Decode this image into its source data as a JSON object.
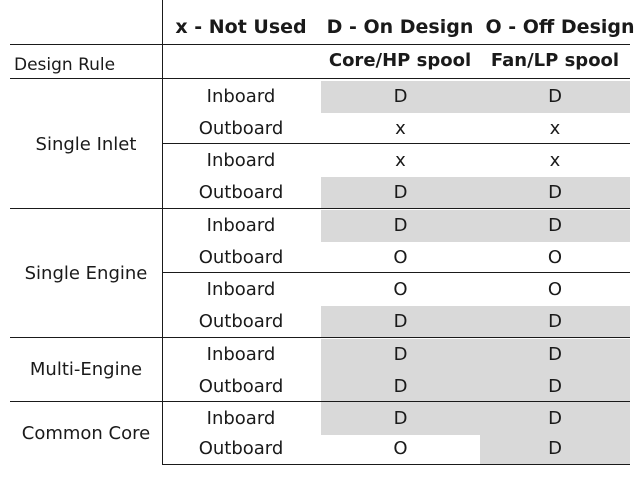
{
  "header": {
    "legend_x": "x - Not Used",
    "legend_d": "D - On Design",
    "legend_o": "O - Off Design",
    "col_design_rule": "Design Rule",
    "col_core": "Core/HP spool",
    "col_fan": "Fan/LP spool"
  },
  "groups": [
    {
      "label": "Single Inlet"
    },
    {
      "label": "Single Engine"
    },
    {
      "label": "Multi-Engine"
    },
    {
      "label": "Common Core"
    }
  ],
  "rows": [
    {
      "position": "Inboard",
      "core": "D",
      "fan": "D",
      "core_gray": true,
      "fan_gray": true
    },
    {
      "position": "Outboard",
      "core": "x",
      "fan": "x",
      "core_gray": false,
      "fan_gray": false
    },
    {
      "position": "Inboard",
      "core": "x",
      "fan": "x",
      "core_gray": false,
      "fan_gray": false
    },
    {
      "position": "Outboard",
      "core": "D",
      "fan": "D",
      "core_gray": true,
      "fan_gray": true
    },
    {
      "position": "Inboard",
      "core": "D",
      "fan": "D",
      "core_gray": true,
      "fan_gray": true
    },
    {
      "position": "Outboard",
      "core": "O",
      "fan": "O",
      "core_gray": false,
      "fan_gray": false
    },
    {
      "position": "Inboard",
      "core": "O",
      "fan": "O",
      "core_gray": false,
      "fan_gray": false
    },
    {
      "position": "Outboard",
      "core": "D",
      "fan": "D",
      "core_gray": true,
      "fan_gray": true
    },
    {
      "position": "Inboard",
      "core": "D",
      "fan": "D",
      "core_gray": true,
      "fan_gray": true
    },
    {
      "position": "Outboard",
      "core": "D",
      "fan": "D",
      "core_gray": true,
      "fan_gray": true
    },
    {
      "position": "Inboard",
      "core": "D",
      "fan": "D",
      "core_gray": true,
      "fan_gray": true
    },
    {
      "position": "Outboard",
      "core": "O",
      "fan": "D",
      "core_gray": false,
      "fan_gray": true
    }
  ]
}
